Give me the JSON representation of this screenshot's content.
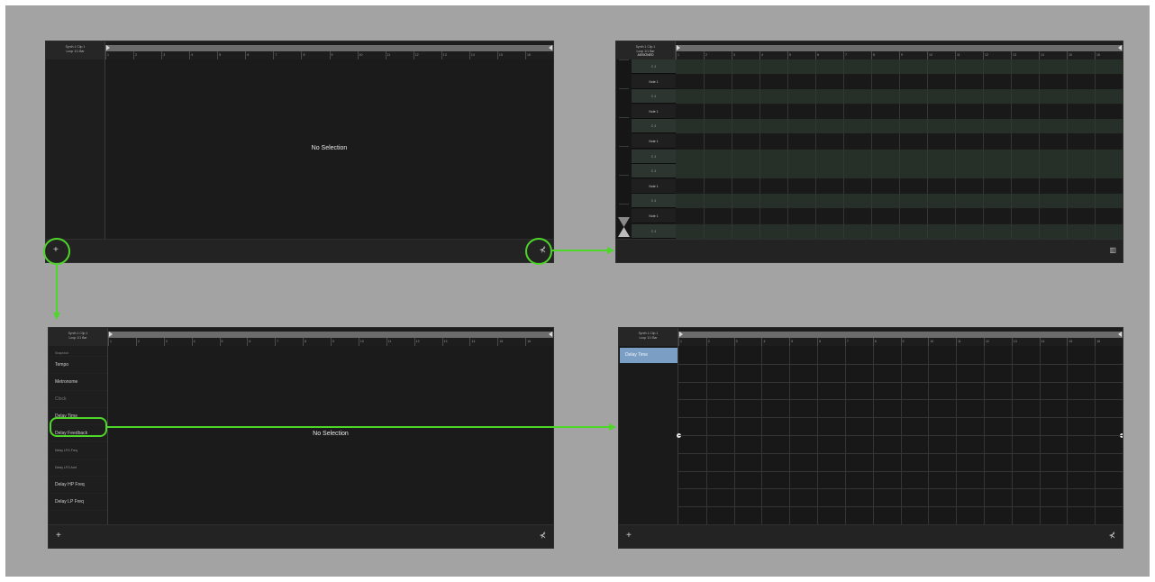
{
  "header": {
    "line1": "Synth 1 Clip 1",
    "line2": "Loop 1/1 Bar",
    "line3": "ASSIGNED"
  },
  "ruler": {
    "ticks": [
      "1",
      "2",
      "3",
      "4",
      "5",
      "6",
      "7",
      "8",
      "9",
      "10",
      "11",
      "12",
      "13",
      "14",
      "15",
      "16"
    ]
  },
  "main": {
    "no_selection": "No Selection"
  },
  "footer": {
    "add_symbol": "+",
    "fx_symbol": "⊀",
    "grid_symbol": "▥"
  },
  "pads": {
    "rows": [
      "C 4",
      "Note 1",
      "C 4",
      "Note 1",
      "C 4",
      "Note 1",
      "C 4",
      "C 4",
      "Note 1",
      "C 4",
      "Note 1",
      "C 4"
    ]
  },
  "params": {
    "header": "Snapshot",
    "items": [
      "Tempo",
      "Metronome",
      "Clock",
      "Delay Time",
      "Delay Feedback",
      "Delay LFO Freq",
      "Delay LFO Amt",
      "Delay HP Freq",
      "Delay LP Freq"
    ]
  },
  "automation": {
    "selected": "Delay Time",
    "level": 0.5
  },
  "colors": {
    "highlight": "#4ed62a",
    "selected_param": "#7b9fc4"
  }
}
